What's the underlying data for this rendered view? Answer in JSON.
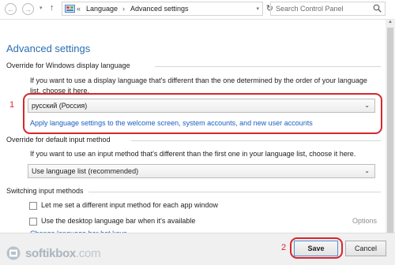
{
  "nav": {
    "back_glyph": "←",
    "forward_glyph": "→",
    "dropdown_glyph": "▾",
    "up_glyph": "↑",
    "breadcrumb_arrow": "«",
    "crumbs": [
      "Language",
      "Advanced settings"
    ],
    "crumb_separator": "›",
    "refresh_glyph": "↻",
    "search_placeholder": "Search Control Panel"
  },
  "page": {
    "title": "Advanced settings"
  },
  "display_language": {
    "heading": "Override for Windows display language",
    "description": "If you want to use a display language that's different than the one determined by the order of your language list, choose it here.",
    "selected": "русский (Россия)",
    "link": "Apply language settings to the welcome screen, system accounts, and new user accounts",
    "marker": "1"
  },
  "input_method": {
    "heading": "Override for default input method",
    "description": "If you want to use an input method that's different than the first one in your language list, choose it here.",
    "selected": "Use language list (recommended)"
  },
  "switching": {
    "heading": "Switching input methods",
    "checkbox1": "Let me set a different input method for each app window",
    "checkbox2": "Use the desktop language bar when it's available",
    "options_link": "Options",
    "cut_link": "Change language bar hot keys"
  },
  "footer": {
    "marker": "2",
    "save": "Save",
    "cancel": "Cancel"
  },
  "watermark": {
    "brand": "softikbox",
    "tld": ".com"
  },
  "colors": {
    "accent_blue": "#2a6fb2",
    "link_blue": "#1a5ec2",
    "annotation_red": "#d8262c"
  }
}
